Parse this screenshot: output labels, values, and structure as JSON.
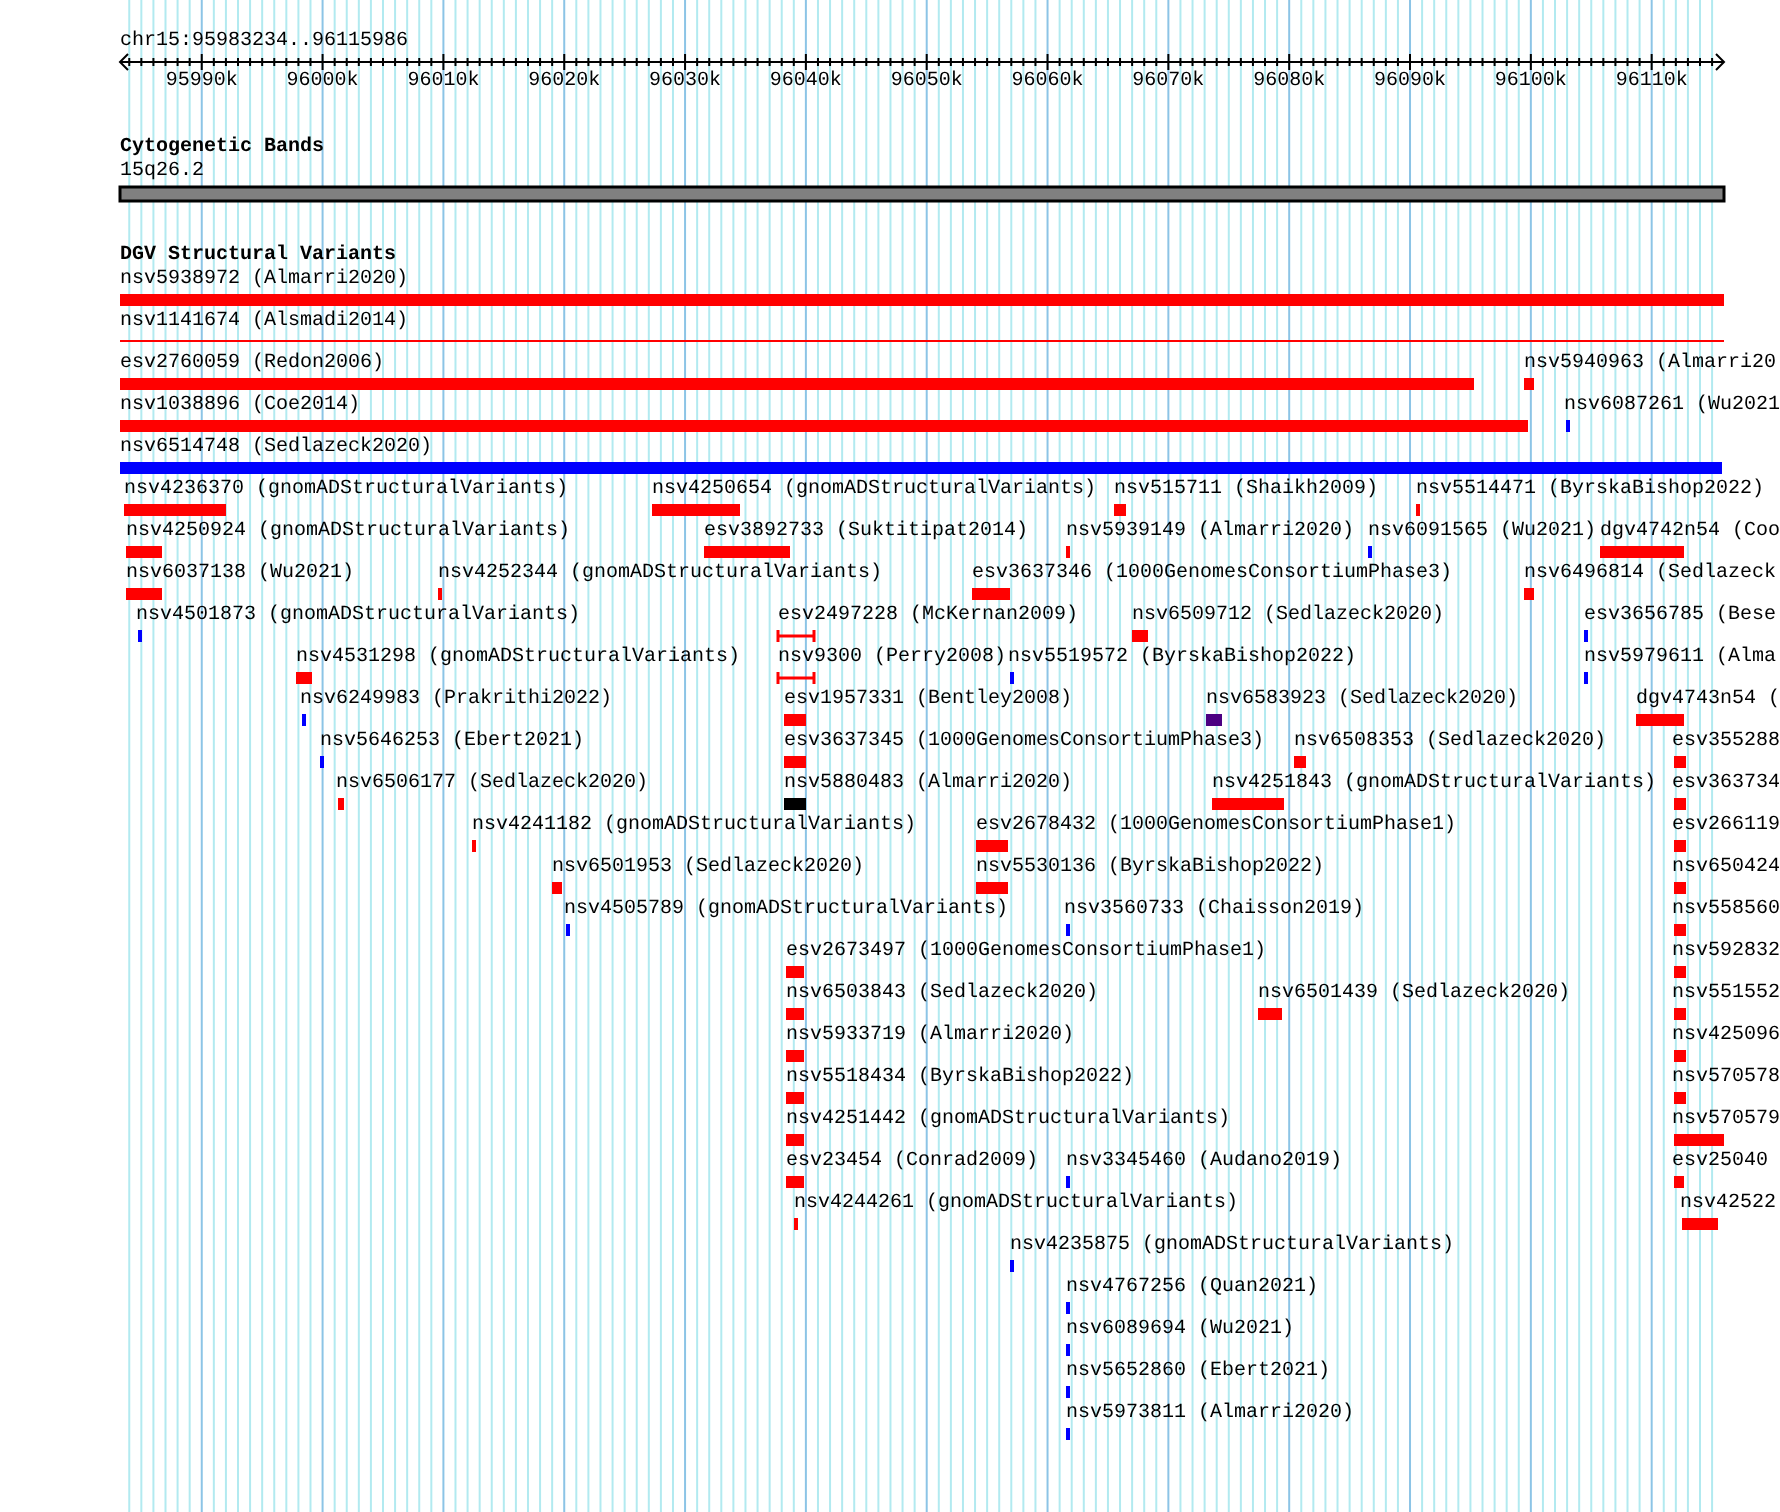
{
  "location": "chr15:95983234..96115986",
  "ruler": {
    "ticks": [
      "95990k",
      "96000k",
      "96010k",
      "96020k",
      "96030k",
      "96040k",
      "96050k",
      "96060k",
      "96070k",
      "96080k",
      "96090k",
      "96100k",
      "96110k"
    ]
  },
  "cytoband_track": {
    "title": "Cytogenetic Bands",
    "bands": [
      {
        "label": "15q26.2"
      }
    ]
  },
  "dgv_track": {
    "title": "DGV Structural Variants",
    "features": [
      {
        "label": "nsv5938972 (Almarri2020)",
        "kind": "bar",
        "color": "#ff0000"
      },
      {
        "label": "nsv1141674 (Alsmadi2014)",
        "kind": "line",
        "color": "#ff0000"
      },
      {
        "label": "esv2760059 (Redon2006)",
        "kind": "bar",
        "color": "#ff0000"
      },
      {
        "label": "nsv5940963 (Almarri20",
        "kind": "bar",
        "color": "#ff0000"
      },
      {
        "label": "nsv1038896 (Coe2014)",
        "kind": "bar",
        "color": "#ff0000"
      },
      {
        "label": "nsv6087261 (Wu2021",
        "kind": "bar",
        "color": "#0000ff"
      },
      {
        "label": "nsv6514748 (Sedlazeck2020)",
        "kind": "bar",
        "color": "#0000ff"
      },
      {
        "label": "nsv4236370 (gnomADStructuralVariants)",
        "kind": "bar",
        "color": "#ff0000"
      },
      {
        "label": "nsv4250654 (gnomADStructuralVariants)",
        "kind": "bar",
        "color": "#ff0000"
      },
      {
        "label": "nsv515711 (Shaikh2009)",
        "kind": "bar",
        "color": "#ff0000"
      },
      {
        "label": "nsv5514471 (ByrskaBishop2022)",
        "kind": "bar",
        "color": "#ff0000"
      },
      {
        "label": "nsv4250924 (gnomADStructuralVariants)",
        "kind": "bar",
        "color": "#ff0000"
      },
      {
        "label": "esv3892733 (Suktitipat2014)",
        "kind": "bar",
        "color": "#ff0000"
      },
      {
        "label": "nsv5939149 (Almarri2020)",
        "kind": "bar",
        "color": "#ff0000"
      },
      {
        "label": "nsv6091565 (Wu2021)",
        "kind": "bar",
        "color": "#0000ff"
      },
      {
        "label": "dgv4742n54 (Coo",
        "kind": "bar",
        "color": "#ff0000"
      },
      {
        "label": "nsv6037138 (Wu2021)",
        "kind": "bar",
        "color": "#ff0000"
      },
      {
        "label": "nsv4252344 (gnomADStructuralVariants)",
        "kind": "bar",
        "color": "#ff0000"
      },
      {
        "label": "esv3637346 (1000GenomesConsortiumPhase3)",
        "kind": "bar",
        "color": "#ff0000"
      },
      {
        "label": "nsv6496814 (Sedlazeck",
        "kind": "bar",
        "color": "#ff0000"
      },
      {
        "label": "nsv4501873 (gnomADStructuralVariants)",
        "kind": "bar",
        "color": "#0000ff"
      },
      {
        "label": "esv2497228 (McKernan2009)",
        "kind": "range",
        "color": "#ff0000"
      },
      {
        "label": "nsv6509712 (Sedlazeck2020)",
        "kind": "bar",
        "color": "#ff0000"
      },
      {
        "label": "esv3656785 (Bese",
        "kind": "bar",
        "color": "#0000ff"
      },
      {
        "label": "nsv4531298 (gnomADStructuralVariants)",
        "kind": "bar",
        "color": "#ff0000"
      },
      {
        "label": "nsv9300 (Perry2008)",
        "kind": "range",
        "color": "#ff0000"
      },
      {
        "label": "nsv5519572 (ByrskaBishop2022)",
        "kind": "bar",
        "color": "#0000ff"
      },
      {
        "label": "nsv5979611 (Alma",
        "kind": "bar",
        "color": "#0000ff"
      },
      {
        "label": "nsv6249983 (Prakrithi2022)",
        "kind": "bar",
        "color": "#0000ff"
      },
      {
        "label": "esv1957331 (Bentley2008)",
        "kind": "bar",
        "color": "#ff0000"
      },
      {
        "label": "nsv6583923 (Sedlazeck2020)",
        "kind": "bar",
        "color": "#4b0082"
      },
      {
        "label": "dgv4743n54 (",
        "kind": "bar",
        "color": "#ff0000"
      },
      {
        "label": "nsv5646253 (Ebert2021)",
        "kind": "bar",
        "color": "#0000ff"
      },
      {
        "label": "esv3637345 (1000GenomesConsortiumPhase3)",
        "kind": "bar",
        "color": "#ff0000"
      },
      {
        "label": "nsv6508353 (Sedlazeck2020)",
        "kind": "bar",
        "color": "#ff0000"
      },
      {
        "label": "esv355288",
        "kind": "bar",
        "color": "#ff0000"
      },
      {
        "label": "nsv6506177 (Sedlazeck2020)",
        "kind": "bar",
        "color": "#ff0000"
      },
      {
        "label": "nsv5880483 (Almarri2020)",
        "kind": "bar",
        "color": "#000000"
      },
      {
        "label": "nsv4251843 (gnomADStructuralVariants)",
        "kind": "bar",
        "color": "#ff0000"
      },
      {
        "label": "esv363734",
        "kind": "bar",
        "color": "#ff0000"
      },
      {
        "label": "nsv4241182 (gnomADStructuralVariants)",
        "kind": "bar",
        "color": "#ff0000"
      },
      {
        "label": "esv2678432 (1000GenomesConsortiumPhase1)",
        "kind": "bar",
        "color": "#ff0000"
      },
      {
        "label": "esv266119",
        "kind": "bar",
        "color": "#ff0000"
      },
      {
        "label": "nsv6501953 (Sedlazeck2020)",
        "kind": "bar",
        "color": "#ff0000"
      },
      {
        "label": "nsv5530136 (ByrskaBishop2022)",
        "kind": "bar",
        "color": "#ff0000"
      },
      {
        "label": "nsv650424",
        "kind": "bar",
        "color": "#ff0000"
      },
      {
        "label": "nsv4505789 (gnomADStructuralVariants)",
        "kind": "bar",
        "color": "#0000ff"
      },
      {
        "label": "nsv3560733 (Chaisson2019)",
        "kind": "bar",
        "color": "#0000ff"
      },
      {
        "label": "nsv558560",
        "kind": "bar",
        "color": "#ff0000"
      },
      {
        "label": "esv2673497 (1000GenomesConsortiumPhase1)",
        "kind": "bar",
        "color": "#ff0000"
      },
      {
        "label": "nsv592832",
        "kind": "bar",
        "color": "#ff0000"
      },
      {
        "label": "nsv6503843 (Sedlazeck2020)",
        "kind": "bar",
        "color": "#ff0000"
      },
      {
        "label": "nsv6501439 (Sedlazeck2020)",
        "kind": "bar",
        "color": "#ff0000"
      },
      {
        "label": "nsv551552",
        "kind": "bar",
        "color": "#ff0000"
      },
      {
        "label": "nsv5933719 (Almarri2020)",
        "kind": "bar",
        "color": "#ff0000"
      },
      {
        "label": "nsv425096",
        "kind": "bar",
        "color": "#ff0000"
      },
      {
        "label": "nsv5518434 (ByrskaBishop2022)",
        "kind": "bar",
        "color": "#ff0000"
      },
      {
        "label": "nsv570578",
        "kind": "bar",
        "color": "#ff0000"
      },
      {
        "label": "nsv4251442 (gnomADStructuralVariants)",
        "kind": "bar",
        "color": "#ff0000"
      },
      {
        "label": "nsv570579",
        "kind": "bar",
        "color": "#ff0000"
      },
      {
        "label": "esv23454 (Conrad2009)",
        "kind": "bar",
        "color": "#ff0000"
      },
      {
        "label": "nsv3345460 (Audano2019)",
        "kind": "bar",
        "color": "#0000ff"
      },
      {
        "label": "esv25040",
        "kind": "bar",
        "color": "#ff0000"
      },
      {
        "label": "nsv4244261 (gnomADStructuralVariants)",
        "kind": "bar",
        "color": "#ff0000"
      },
      {
        "label": "nsv42522",
        "kind": "bar",
        "color": "#ff0000"
      },
      {
        "label": "nsv4235875 (gnomADStructuralVariants)",
        "kind": "bar",
        "color": "#0000ff"
      },
      {
        "label": "nsv4767256 (Quan2021)",
        "kind": "bar",
        "color": "#0000ff"
      },
      {
        "label": "nsv6089694 (Wu2021)",
        "kind": "bar",
        "color": "#0000ff"
      },
      {
        "label": "nsv5652860 (Ebert2021)",
        "kind": "bar",
        "color": "#0000ff"
      },
      {
        "label": "nsv5973811 (Almarri2020)",
        "kind": "bar",
        "color": "#0000ff"
      }
    ]
  }
}
